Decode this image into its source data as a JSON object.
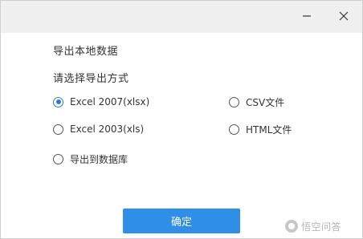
{
  "dialog": {
    "title_text": "导出本地数据",
    "prompt_text": "请选择导出方式",
    "window_buttons": {
      "minimize_icon": "minus-icon",
      "close_icon": "close-icon"
    }
  },
  "options": [
    {
      "label": "Excel 2007(xlsx)",
      "selected": true
    },
    {
      "label": "CSV文件",
      "selected": false
    },
    {
      "label": "Excel 2003(xls)",
      "selected": false
    },
    {
      "label": "HTML文件",
      "selected": false
    },
    {
      "label": "导出到数据库",
      "selected": false
    }
  ],
  "confirm_label": "确定",
  "watermark": {
    "text": "悟空问答",
    "icon": "wukong-logo-icon"
  },
  "colors": {
    "accent": "#2f8fe6",
    "titlebar": "#f0f0f0",
    "text": "#333333",
    "radio_checked": "#2b7bd6"
  }
}
